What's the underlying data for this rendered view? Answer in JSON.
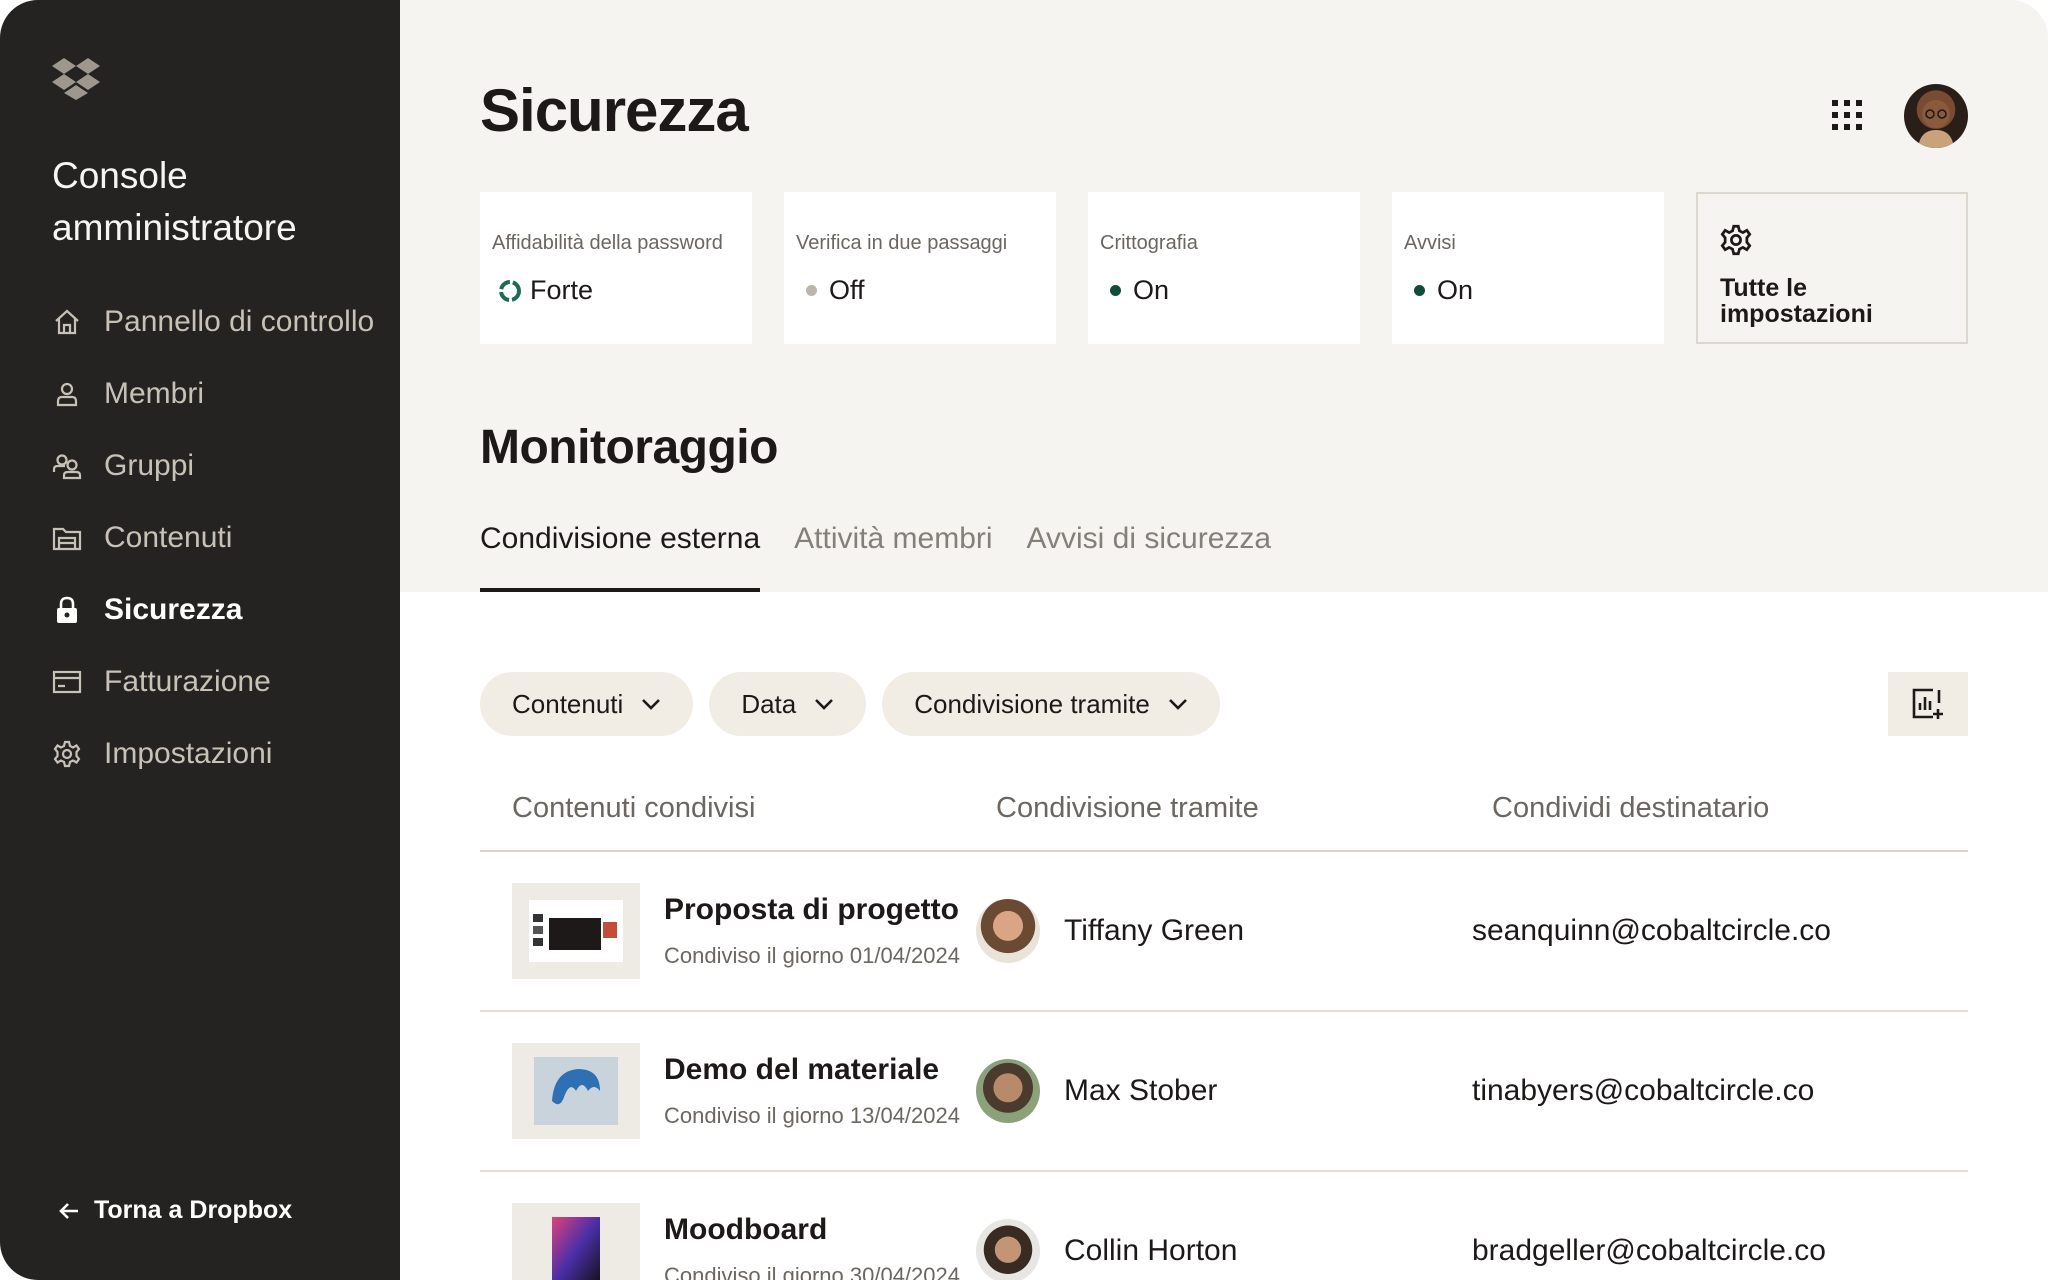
{
  "sidebar": {
    "logo_icon": "dropbox-logo-icon",
    "title": "Console amministratore",
    "items": [
      {
        "label": "Pannello di controllo",
        "icon": "home-icon"
      },
      {
        "label": "Membri",
        "icon": "user-icon"
      },
      {
        "label": "Gruppi",
        "icon": "group-icon"
      },
      {
        "label": "Contenuti",
        "icon": "folder-icon"
      },
      {
        "label": "Sicurezza",
        "icon": "lock-icon",
        "active": true
      },
      {
        "label": "Fatturazione",
        "icon": "card-icon"
      },
      {
        "label": "Impostazioni",
        "icon": "gear-icon"
      }
    ],
    "back_label": "Torna a Dropbox"
  },
  "header": {
    "title": "Sicurezza",
    "apps_icon": "grid-icon",
    "avatar_icon": "user-avatar"
  },
  "cards": [
    {
      "label": "Affidabilità della password",
      "value": "Forte",
      "indicator": "ring",
      "color": "#1d6b56"
    },
    {
      "label": "Verifica in due passaggi",
      "value": "Off",
      "indicator": "dot",
      "color": "#bbb5ab"
    },
    {
      "label": "Crittografia",
      "value": "On",
      "indicator": "dot",
      "color": "#0f4d3a"
    },
    {
      "label": "Avvisi",
      "value": "On",
      "indicator": "dot",
      "color": "#0f4d3a"
    }
  ],
  "settings_card": {
    "label": "Tutte le impostazioni",
    "icon": "gear-icon"
  },
  "monitor": {
    "title": "Monitoraggio",
    "tabs": [
      {
        "label": "Condivisione esterna",
        "active": true
      },
      {
        "label": "Attività membri"
      },
      {
        "label": "Avvisi di sicurezza"
      }
    ]
  },
  "filters": [
    {
      "label": "Contenuti"
    },
    {
      "label": "Data"
    },
    {
      "label": "Condivisione tramite"
    }
  ],
  "report_icon": "add-report-icon",
  "table": {
    "headers": [
      "Contenuti condivisi",
      "Condivisione tramite",
      "Condividi destinatario"
    ],
    "rows": [
      {
        "file": "Proposta di progetto",
        "date": "Condiviso il giorno 01/04/2024",
        "person": "Tiffany Green",
        "recipient": "seanquinn@cobaltcircle.co"
      },
      {
        "file": "Demo del materiale",
        "date": "Condiviso il giorno 13/04/2024",
        "person": "Max Stober",
        "recipient": "tinabyers@cobaltcircle.co"
      },
      {
        "file": "Moodboard",
        "date": "Condiviso il giorno 30/04/2024",
        "person": "Collin Horton",
        "recipient": "bradgeller@cobaltcircle.co"
      }
    ]
  },
  "colors": {
    "sidebar_bg": "#242322",
    "main_bg": "#f6f4f0",
    "accent": "#0f4d3a",
    "pill_bg": "#f1ede5"
  }
}
